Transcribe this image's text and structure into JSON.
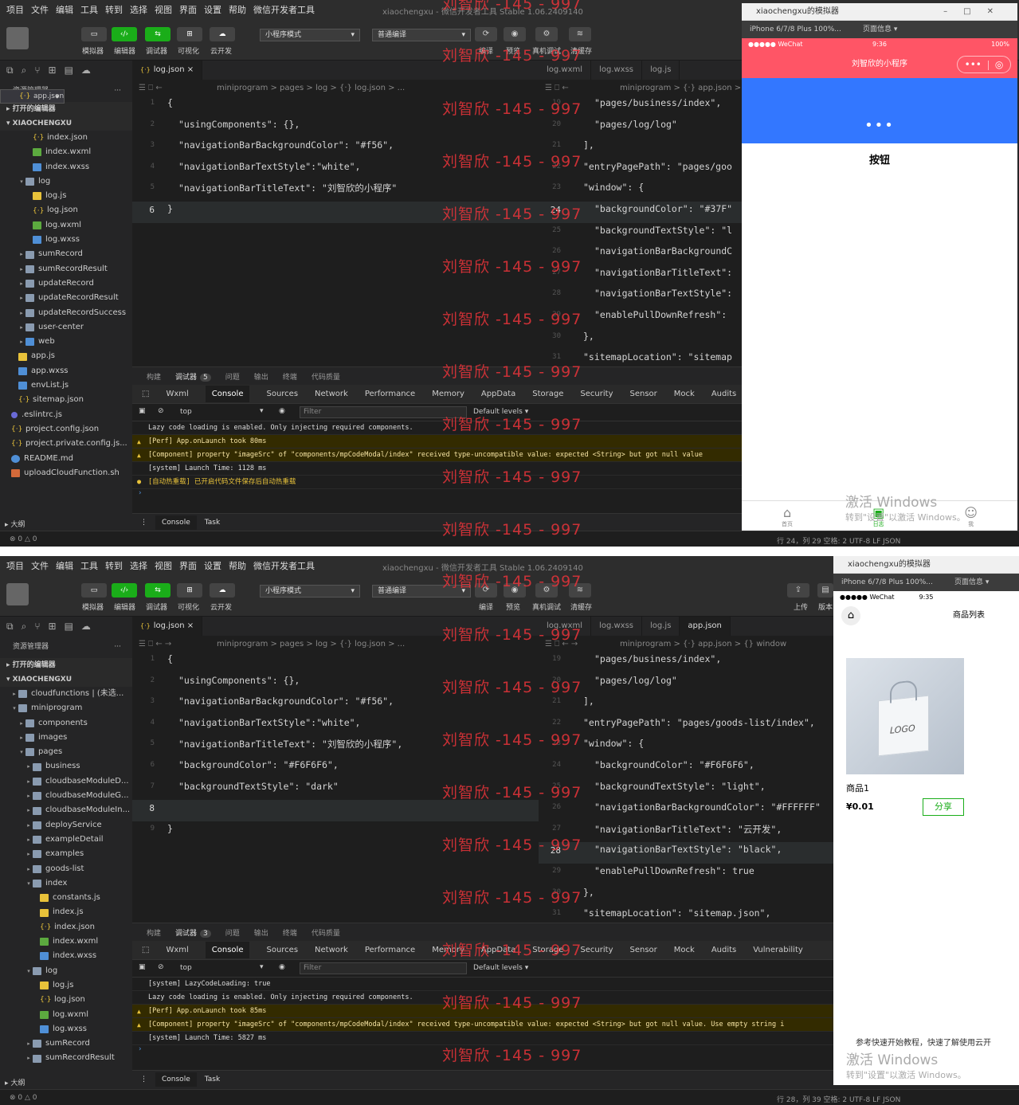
{
  "menu": [
    "项目",
    "文件",
    "编辑",
    "工具",
    "转到",
    "选择",
    "视图",
    "界面",
    "设置",
    "帮助",
    "微信开发者工具"
  ],
  "window_title": "xiaochengxu - 微信开发者工具 Stable 1.06.2409140",
  "toolbar": {
    "labels": [
      "模拟器",
      "编辑器",
      "调试器",
      "可视化",
      "云开发"
    ],
    "mode_select": "小程序模式",
    "compile_select": "普通编译",
    "right_labels": [
      "编译",
      "预览",
      "真机调试",
      "清缓存"
    ],
    "upload_labels": [
      "上传",
      "版本"
    ]
  },
  "sidebar": {
    "header": "资源管理器",
    "header_dots": "···",
    "open_editors": "打开的编辑器",
    "project": "XIAOCHENGXU",
    "outline": "大纲",
    "problems": "⊗ 0 △ 0"
  },
  "tree_top": [
    {
      "a": "",
      "i": "json",
      "t": "index.json",
      "d": 3
    },
    {
      "a": "",
      "i": "wxml",
      "t": "index.wxml",
      "d": 3
    },
    {
      "a": "",
      "i": "wxss",
      "t": "index.wxss",
      "d": 3
    },
    {
      "a": "▾",
      "i": "folder",
      "t": "log",
      "d": 2
    },
    {
      "a": "",
      "i": "js",
      "t": "log.js",
      "d": 3
    },
    {
      "a": "",
      "i": "json",
      "t": "log.json",
      "d": 3
    },
    {
      "a": "",
      "i": "wxml",
      "t": "log.wxml",
      "d": 3
    },
    {
      "a": "",
      "i": "wxss",
      "t": "log.wxss",
      "d": 3
    },
    {
      "a": "▸",
      "i": "folder",
      "t": "sumRecord",
      "d": 2
    },
    {
      "a": "▸",
      "i": "folder",
      "t": "sumRecordResult",
      "d": 2
    },
    {
      "a": "▸",
      "i": "folder",
      "t": "updateRecord",
      "d": 2
    },
    {
      "a": "▸",
      "i": "folder",
      "t": "updateRecordResult",
      "d": 2
    },
    {
      "a": "▸",
      "i": "folder",
      "t": "updateRecordSuccess",
      "d": 2
    },
    {
      "a": "▸",
      "i": "folder",
      "t": "user-center",
      "d": 2
    },
    {
      "a": "▸",
      "i": "wxss",
      "t": "web",
      "d": 2
    },
    {
      "a": "",
      "i": "js",
      "t": "app.js",
      "d": 1
    },
    {
      "a": "",
      "i": "json",
      "t": "app.json",
      "d": 1,
      "sel": true
    },
    {
      "a": "",
      "i": "wxss",
      "t": "app.wxss",
      "d": 1
    },
    {
      "a": "",
      "i": "wxss",
      "t": "envList.js",
      "d": 1
    },
    {
      "a": "",
      "i": "json",
      "t": "sitemap.json",
      "d": 1
    },
    {
      "a": "",
      "i": "rc",
      "t": ".eslintrc.js",
      "d": 0
    },
    {
      "a": "",
      "i": "json",
      "t": "project.config.json",
      "d": 0
    },
    {
      "a": "",
      "i": "json",
      "t": "project.private.config.js...",
      "d": 0
    },
    {
      "a": "",
      "i": "md",
      "t": "README.md",
      "d": 0
    },
    {
      "a": "",
      "i": "sh",
      "t": "uploadCloudFunction.sh",
      "d": 0
    }
  ],
  "tree_bot": [
    {
      "a": "▸",
      "i": "folder",
      "t": "cloudfunctions | (未选...",
      "d": 1
    },
    {
      "a": "▾",
      "i": "folder",
      "t": "miniprogram",
      "d": 1
    },
    {
      "a": "▸",
      "i": "folder",
      "t": "components",
      "d": 2
    },
    {
      "a": "▸",
      "i": "folder",
      "t": "images",
      "d": 2
    },
    {
      "a": "▾",
      "i": "folder",
      "t": "pages",
      "d": 2
    },
    {
      "a": "▸",
      "i": "folder",
      "t": "business",
      "d": 3
    },
    {
      "a": "▸",
      "i": "folder",
      "t": "cloudbaseModuleD...",
      "d": 3
    },
    {
      "a": "▸",
      "i": "folder",
      "t": "cloudbaseModuleG...",
      "d": 3
    },
    {
      "a": "▸",
      "i": "folder",
      "t": "cloudbaseModuleIn...",
      "d": 3
    },
    {
      "a": "▸",
      "i": "folder",
      "t": "deployService",
      "d": 3
    },
    {
      "a": "▸",
      "i": "folder",
      "t": "exampleDetail",
      "d": 3
    },
    {
      "a": "▸",
      "i": "folder",
      "t": "examples",
      "d": 3
    },
    {
      "a": "▸",
      "i": "folder",
      "t": "goods-list",
      "d": 3
    },
    {
      "a": "▾",
      "i": "folder",
      "t": "index",
      "d": 3
    },
    {
      "a": "",
      "i": "js",
      "t": "constants.js",
      "d": 4
    },
    {
      "a": "",
      "i": "js",
      "t": "index.js",
      "d": 4
    },
    {
      "a": "",
      "i": "json",
      "t": "index.json",
      "d": 4
    },
    {
      "a": "",
      "i": "wxml",
      "t": "index.wxml",
      "d": 4
    },
    {
      "a": "",
      "i": "wxss",
      "t": "index.wxss",
      "d": 4
    },
    {
      "a": "▾",
      "i": "folder",
      "t": "log",
      "d": 3
    },
    {
      "a": "",
      "i": "js",
      "t": "log.js",
      "d": 4
    },
    {
      "a": "",
      "i": "json",
      "t": "log.json",
      "d": 4
    },
    {
      "a": "",
      "i": "wxml",
      "t": "log.wxml",
      "d": 4
    },
    {
      "a": "",
      "i": "wxss",
      "t": "log.wxss",
      "d": 4
    },
    {
      "a": "▸",
      "i": "folder",
      "t": "sumRecord",
      "d": 3
    },
    {
      "a": "▸",
      "i": "folder",
      "t": "sumRecordResult",
      "d": 3
    }
  ],
  "editor_left": {
    "tab": "log.json",
    "crumb": "miniprogram > pages > log > {·} log.json > ...",
    "top_lines": [
      {
        "n": "1",
        "c": "{"
      },
      {
        "n": "2",
        "c": "\"usingComponents\": {},",
        "i": 1
      },
      {
        "n": "3",
        "c": "\"navigationBarBackgroundColor\": \"#f56\",",
        "i": 1
      },
      {
        "n": "4",
        "c": "\"navigationBarTextStyle\":\"white\",",
        "i": 1
      },
      {
        "n": "5",
        "c": "\"navigationBarTitleText\": \"刘智欣的小程序\"",
        "i": 1
      },
      {
        "n": "6",
        "c": "}",
        "cur": true
      }
    ],
    "bot_lines": [
      {
        "n": "1",
        "c": "{"
      },
      {
        "n": "2",
        "c": "\"usingComponents\": {},",
        "i": 1
      },
      {
        "n": "3",
        "c": "\"navigationBarBackgroundColor\": \"#f56\",",
        "i": 1
      },
      {
        "n": "4",
        "c": "\"navigationBarTextStyle\":\"white\",",
        "i": 1
      },
      {
        "n": "5",
        "c": "\"navigationBarTitleText\": \"刘智欣的小程序\",",
        "i": 1
      },
      {
        "n": "6",
        "c": "\"backgroundColor\": \"#F6F6F6\",",
        "i": 1
      },
      {
        "n": "7",
        "c": "\"backgroundTextStyle\": \"dark\"",
        "i": 1
      },
      {
        "n": "8",
        "c": "",
        "cur": true
      },
      {
        "n": "9",
        "c": "}"
      }
    ]
  },
  "editor_right": {
    "tabs_top": [
      "log.wxml",
      "log.wxss",
      "log.js"
    ],
    "tabs_bot": [
      "log.wxml",
      "log.wxss",
      "log.js",
      "app.json"
    ],
    "crumb_top": "miniprogram > {·} app.json > ...",
    "crumb_bot": "miniprogram > {·} app.json > {} window",
    "top_lines": [
      {
        "n": "19",
        "c": "\"pages/business/index\",",
        "i": 1
      },
      {
        "n": "20",
        "c": "\"pages/log/log\"",
        "i": 1
      },
      {
        "n": "21",
        "c": "],"
      },
      {
        "n": "22",
        "c": "\"entryPagePath\": \"pages/goo"
      },
      {
        "n": "23",
        "c": "\"window\": {"
      },
      {
        "n": "24",
        "c": "\"backgroundColor\": \"#37F\"",
        "i": 1,
        "cur": true
      },
      {
        "n": "25",
        "c": "\"backgroundTextStyle\": \"l",
        "i": 1
      },
      {
        "n": "26",
        "c": "\"navigationBarBackgroundC",
        "i": 1
      },
      {
        "n": "27",
        "c": "\"navigationBarTitleText\":",
        "i": 1
      },
      {
        "n": "28",
        "c": "\"navigationBarTextStyle\":",
        "i": 1
      },
      {
        "n": "29",
        "c": "\"enablePullDownRefresh\":",
        "i": 1
      },
      {
        "n": "30",
        "c": "},"
      },
      {
        "n": "31",
        "c": "\"sitemapLocation\": \"sitemap"
      }
    ],
    "bot_lines": [
      {
        "n": "19",
        "c": "\"pages/business/index\",",
        "i": 1
      },
      {
        "n": "20",
        "c": "\"pages/log/log\"",
        "i": 1
      },
      {
        "n": "21",
        "c": "],"
      },
      {
        "n": "22",
        "c": "\"entryPagePath\": \"pages/goods-list/index\","
      },
      {
        "n": "23",
        "c": "\"window\": {"
      },
      {
        "n": "24",
        "c": "\"backgroundColor\": \"#F6F6F6\",",
        "i": 1
      },
      {
        "n": "25",
        "c": "\"backgroundTextStyle\": \"light\",",
        "i": 1
      },
      {
        "n": "26",
        "c": "\"navigationBarBackgroundColor\": \"#FFFFFF\"",
        "i": 1
      },
      {
        "n": "27",
        "c": "\"navigationBarTitleText\": \"云开发\",",
        "i": 1
      },
      {
        "n": "28",
        "c": "\"navigationBarTextStyle\": \"black\",",
        "i": 1,
        "cur": true
      },
      {
        "n": "29",
        "c": "\"enablePullDownRefresh\": true",
        "i": 1
      },
      {
        "n": "30",
        "c": "},"
      },
      {
        "n": "31",
        "c": "\"sitemapLocation\": \"sitemap.json\","
      }
    ]
  },
  "devtools": {
    "panel_tabs": [
      "构建",
      "调试器",
      "问题",
      "输出",
      "终端",
      "代码质量"
    ],
    "badge_top": "5",
    "badge_bot": "3",
    "tabs": [
      "Wxml",
      "Console",
      "Sources",
      "Network",
      "Performance",
      "Memory",
      "AppData",
      "Storage",
      "Security",
      "Sensor",
      "Mock",
      "Audits",
      "Vulnerability"
    ],
    "context": "top",
    "filter_placeholder": "Filter",
    "levels": "Default levels ▾",
    "footer_tabs": [
      "Console",
      "Task"
    ],
    "logs_top": [
      {
        "t": "",
        "c": "Lazy code loading is enabled. Only injecting required components."
      },
      {
        "t": "warn",
        "c": "[Perf] App.onLaunch took 80ms"
      },
      {
        "t": "warn",
        "c": "[Component] property \"imageSrc\" of \"components/mpCodeModal/index\" received type-uncompatible value: expected <String> but got null value"
      },
      {
        "t": "",
        "c": "[system] Launch Time: 1128 ms"
      },
      {
        "t": "info",
        "c": "[自动热重载] 已开启代码文件保存后自动热重载"
      }
    ],
    "logs_bot": [
      {
        "t": "",
        "c": "[system] LazyCodeLoading: true"
      },
      {
        "t": "",
        "c": "Lazy code loading is enabled. Only injecting required components."
      },
      {
        "t": "warn",
        "c": "[Perf] App.onLaunch took 85ms"
      },
      {
        "t": "warn",
        "c": "[Component] property \"imageSrc\" of \"components/mpCodeModal/index\" received type-uncompatible value: expected <String> but got null value. Use empty string i"
      },
      {
        "t": "",
        "c": "[system] Launch Time: 5827 ms"
      }
    ]
  },
  "statusbar": {
    "top": "行 24，列 29   空格: 2   UTF-8   LF   JSON",
    "bot": "行 28，列 39   空格: 2   UTF-8   LF   JSON"
  },
  "simulator": {
    "title": "xiaochengxu的模拟器",
    "device": "iPhone 6/7/8 Plus 100%...",
    "page_info": "页面信息 ▾",
    "carrier": "●●●●● WeChat",
    "time_top": "9:36",
    "time_bot": "9:35",
    "battery": "100%",
    "nav_title_top": "刘智欣的小程序",
    "nav_title_bot": "商品列表",
    "capsule": "•••",
    "dots": "•••",
    "button_text": "按钮",
    "tabbar": [
      "首页",
      "日志",
      "我"
    ],
    "product_name": "商品1",
    "product_price": "¥0.01",
    "share": "分享",
    "logo_text": "LOGO",
    "tip": "参考快速开始教程，快速了解使用云开"
  },
  "activate_windows": {
    "line1": "激活 Windows",
    "line2": "转到\"设置\"以激活 Windows。"
  },
  "watermark": "刘智欣 -145 - 997",
  "colors": {
    "nav_red": "#f56",
    "blue_bg": "#3377ff",
    "wechat_green": "#1aad19"
  }
}
